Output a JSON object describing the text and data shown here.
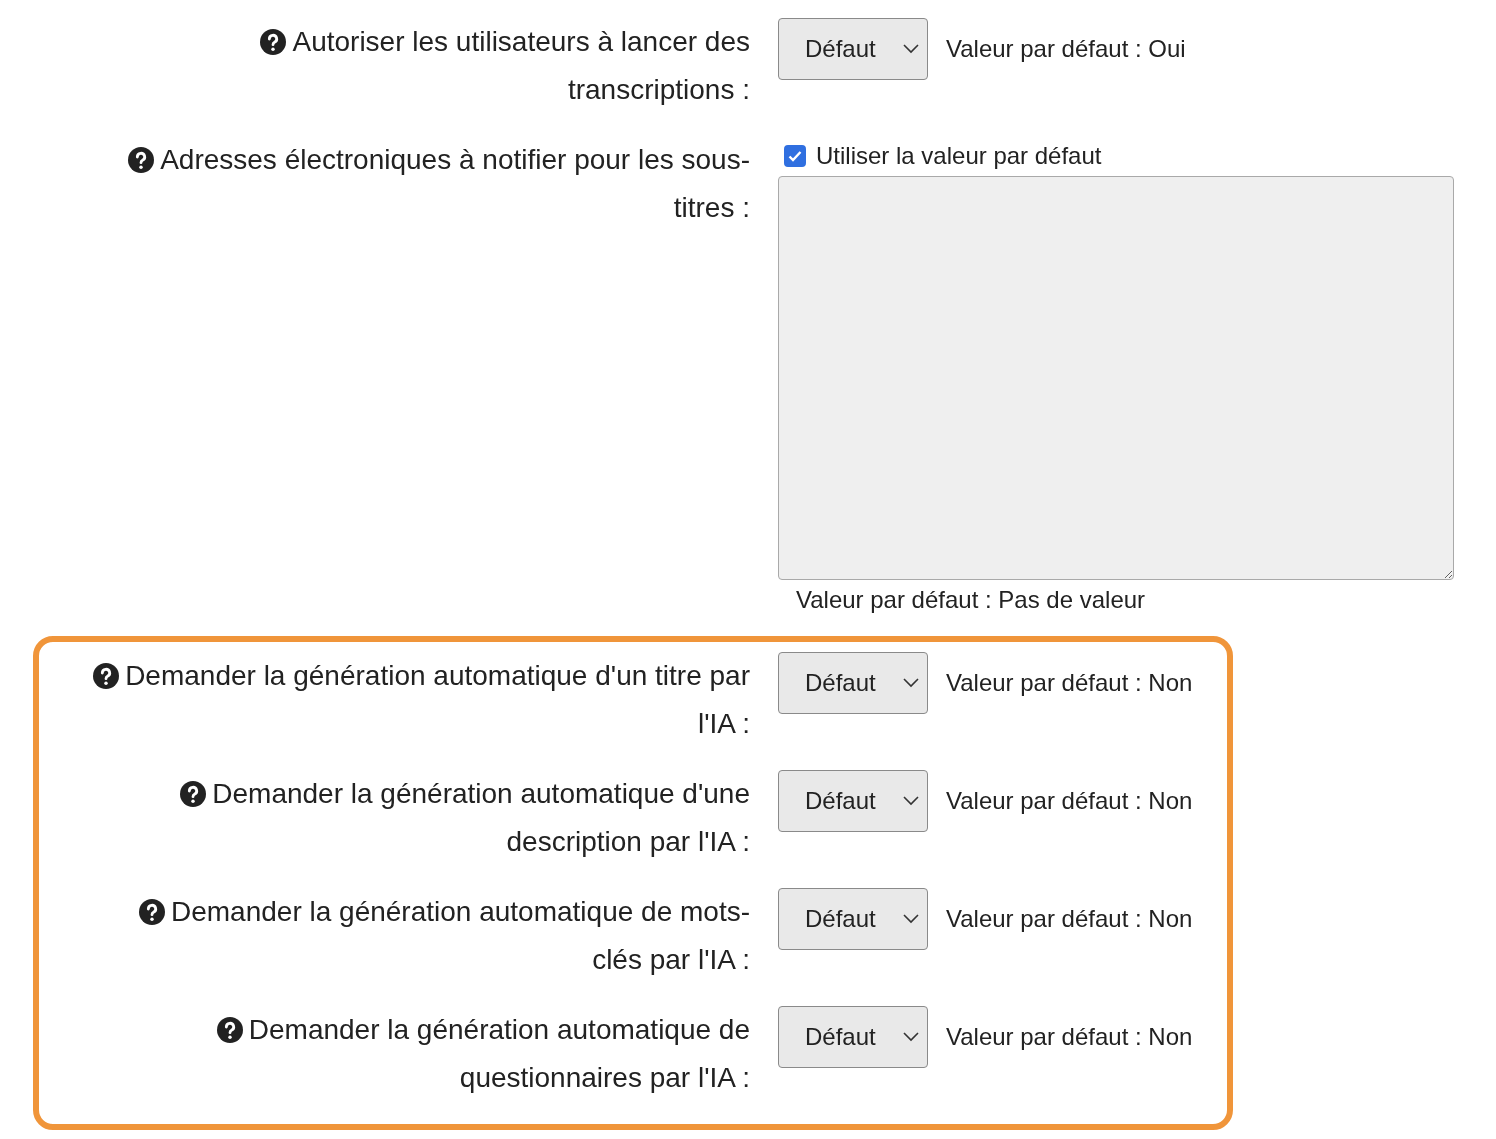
{
  "settings": [
    {
      "kind": "select",
      "label": "Autoriser les utilisateurs à lancer des transcriptions :",
      "value": "Défaut",
      "hint": "Valeur par défaut : Oui"
    },
    {
      "kind": "textarea",
      "label": "Adresses électroniques à notifier pour les sous-titres :",
      "checkbox": {
        "label": "Utiliser la valeur par défaut",
        "checked": true
      },
      "hint": "Valeur par défaut : Pas de valeur"
    }
  ],
  "highlighted_settings": [
    {
      "kind": "select",
      "label": "Demander la génération automatique d'un titre par l'IA :",
      "value": "Défaut",
      "hint": "Valeur par défaut : Non"
    },
    {
      "kind": "select",
      "label": "Demander la génération automatique d'une description par l'IA :",
      "value": "Défaut",
      "hint": "Valeur par défaut : Non"
    },
    {
      "kind": "select",
      "label": "Demander la génération automatique de mots-clés par l'IA :",
      "value": "Défaut",
      "hint": "Valeur par défaut : Non"
    },
    {
      "kind": "select",
      "label": "Demander la génération automatique de questionnaires par l'IA :",
      "value": "Défaut",
      "hint": "Valeur par défaut : Non"
    }
  ]
}
